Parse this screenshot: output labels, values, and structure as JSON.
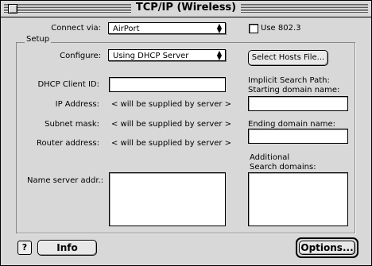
{
  "window": {
    "title": "TCP/IP (Wireless)"
  },
  "connect": {
    "label": "Connect via:",
    "value": "AirPort"
  },
  "use8023": {
    "label": "Use 802.3",
    "checked": false
  },
  "setup": {
    "group_label": "Setup"
  },
  "configure": {
    "label": "Configure:",
    "value": "Using DHCP Server"
  },
  "select_hosts_button": "Select Hosts File...",
  "dhcp_client_id": {
    "label": "DHCP Client ID:",
    "value": ""
  },
  "ip_address": {
    "label": "IP Address:",
    "value": "< will be supplied by server >"
  },
  "subnet_mask": {
    "label": "Subnet mask:",
    "value": "< will be supplied by server >"
  },
  "router_address": {
    "label": "Router address:",
    "value": "< will be supplied by server >"
  },
  "name_server": {
    "label": "Name server addr.:",
    "value": ""
  },
  "implicit_search": {
    "label_line1": "Implicit Search Path:",
    "label_line2": "Starting domain name:",
    "value": ""
  },
  "ending_domain": {
    "label": "Ending domain name:",
    "value": ""
  },
  "additional_search": {
    "label_line1": "Additional",
    "label_line2": "Search domains:",
    "value": ""
  },
  "help_button": "?",
  "info_button": "Info",
  "options_button": "Options..."
}
